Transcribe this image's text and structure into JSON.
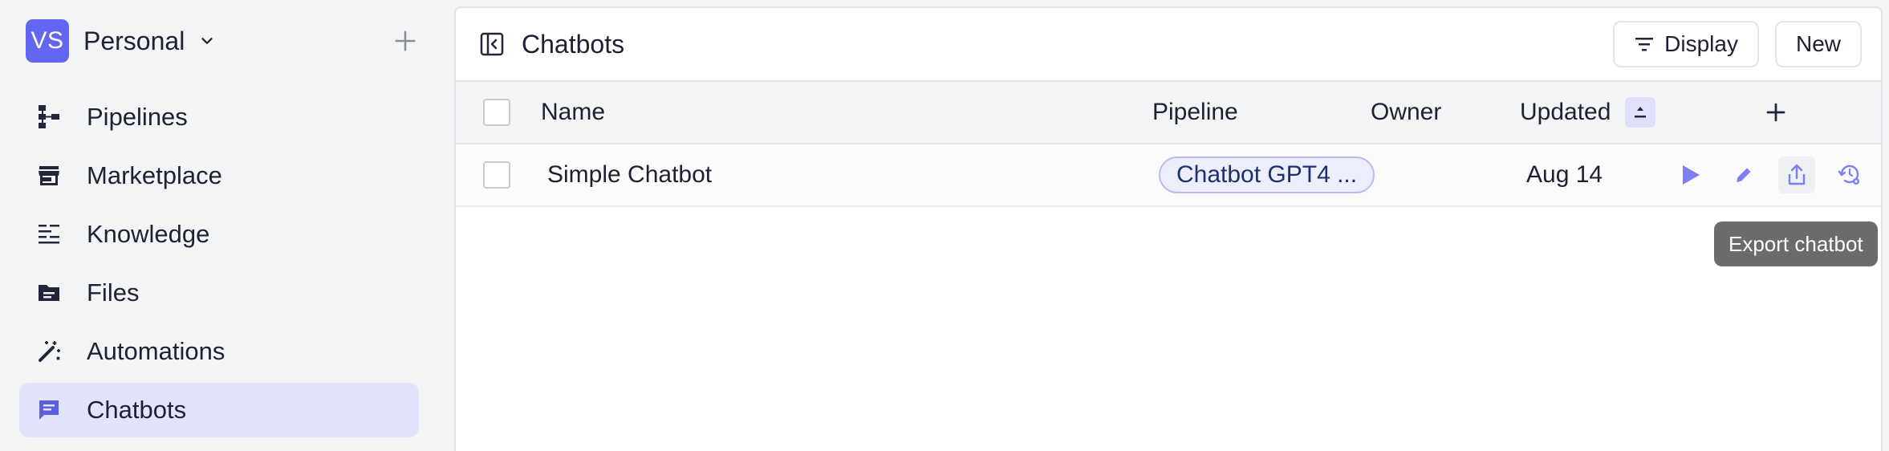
{
  "workspace": {
    "initials": "VS",
    "name": "Personal",
    "chevron_icon": "chevron-down-icon",
    "add_icon": "plus-icon"
  },
  "sidebar": {
    "items": [
      {
        "label": "Pipelines",
        "icon": "pipelines-icon"
      },
      {
        "label": "Marketplace",
        "icon": "store-icon"
      },
      {
        "label": "Knowledge",
        "icon": "knowledge-icon"
      },
      {
        "label": "Files",
        "icon": "folder-icon"
      },
      {
        "label": "Automations",
        "icon": "magic-wand-icon"
      },
      {
        "label": "Chatbots",
        "icon": "chat-icon",
        "active": true
      }
    ]
  },
  "header": {
    "title": "Chatbots",
    "display_label": "Display",
    "new_label": "New"
  },
  "table": {
    "columns": {
      "name": "Name",
      "pipeline": "Pipeline",
      "owner": "Owner",
      "updated": "Updated"
    },
    "rows": [
      {
        "name": "Simple Chatbot",
        "pipeline": "Chatbot GPT4 ...",
        "owner": "",
        "updated": "Aug 14"
      }
    ]
  },
  "tooltip": {
    "text": "Export chatbot"
  },
  "colors": {
    "accent": "#6366f1",
    "active_nav": "#e3e4fb",
    "play": "#7b7ff0"
  }
}
